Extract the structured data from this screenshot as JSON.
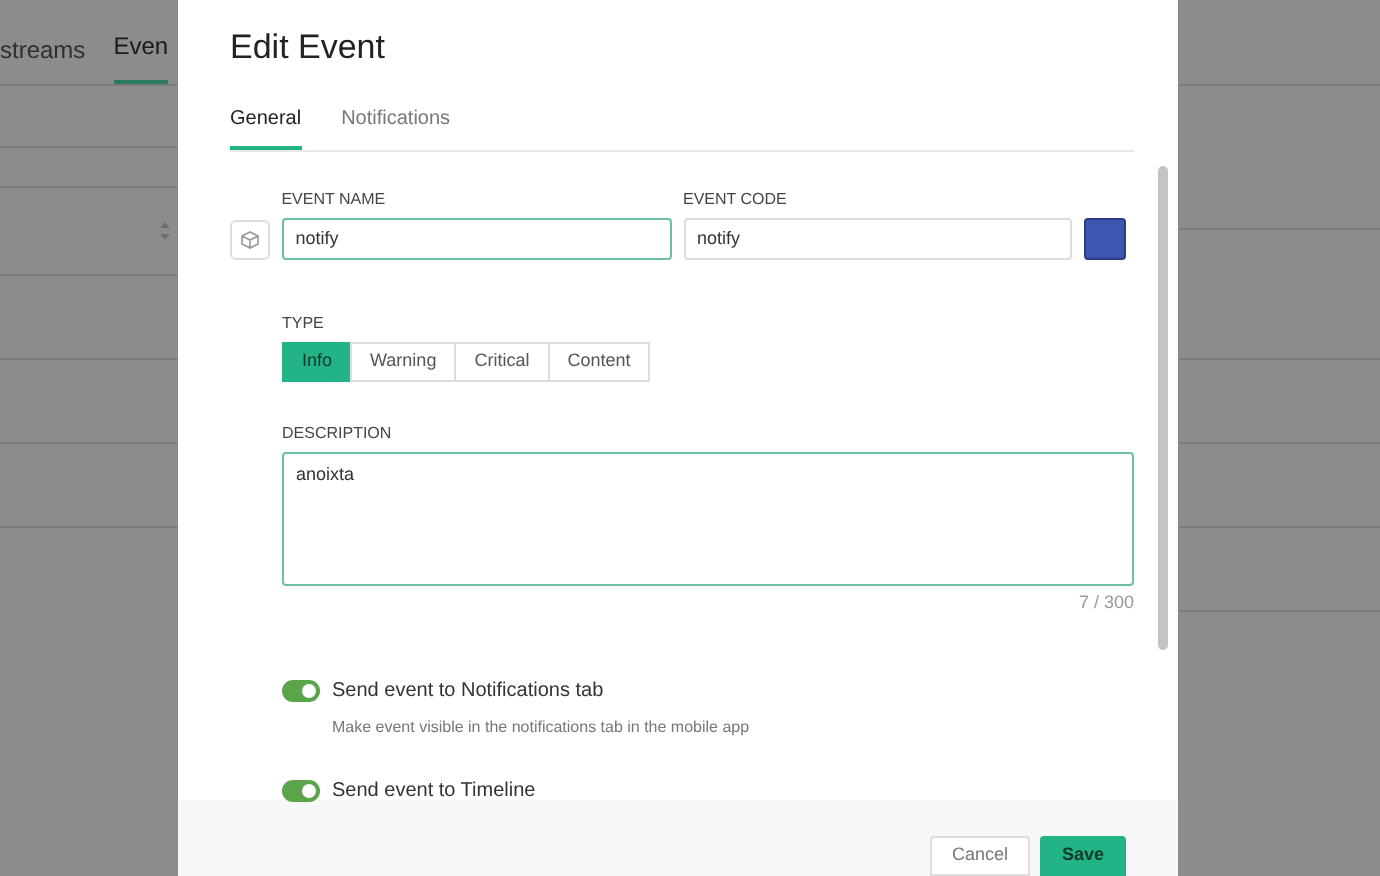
{
  "background_page": {
    "tabs": [
      {
        "label": "streams",
        "selected": false
      },
      {
        "label": "Even",
        "selected": true
      }
    ]
  },
  "dialog": {
    "title": "Edit Event",
    "tabs": [
      {
        "label": "General",
        "selected": true
      },
      {
        "label": "Notifications",
        "selected": false
      }
    ],
    "event_name": {
      "label": "EVENT NAME",
      "value": "notify"
    },
    "event_code": {
      "label": "EVENT CODE",
      "value": "notify"
    },
    "color": "#3f56b0",
    "type": {
      "label": "TYPE",
      "options": [
        {
          "label": "Info",
          "selected": true
        },
        {
          "label": "Warning",
          "selected": false
        },
        {
          "label": "Critical",
          "selected": false
        },
        {
          "label": "Content",
          "selected": false
        }
      ]
    },
    "description": {
      "label": "DESCRIPTION",
      "value": "anoixta",
      "counter": "7 / 300"
    },
    "toggles": [
      {
        "label": "Send event to Notifications tab",
        "hint": "Make event visible in the notifications tab in the mobile app",
        "on": true
      },
      {
        "label": "Send event to Timeline",
        "on": true
      }
    ],
    "buttons": [
      {
        "label": "Cancel",
        "kind": "secondary"
      },
      {
        "label": "Save",
        "kind": "primary"
      }
    ]
  }
}
